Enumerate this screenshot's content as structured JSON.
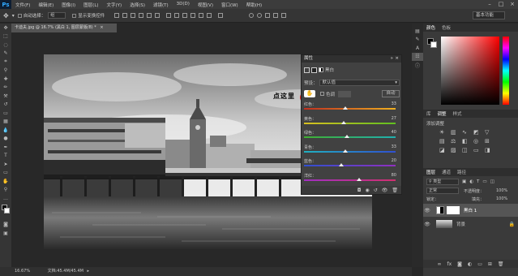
{
  "app": {
    "logo": "Ps"
  },
  "menu": [
    "文件(F)",
    "编辑(E)",
    "图像(I)",
    "图层(L)",
    "文字(Y)",
    "选择(S)",
    "滤镜(T)",
    "3D(D)",
    "视图(V)",
    "窗口(W)",
    "帮助(H)"
  ],
  "options": {
    "auto_select_label": "自动选择：",
    "auto_select_value": "组",
    "transform_label": "显示变换控件",
    "workspace": "基本功能"
  },
  "document": {
    "tab_title": "卡迪夫.jpg @ 16.7% (黑白 1, 图层蒙版/8) *",
    "zoom": "16.67%",
    "doc_info": "文档:45.4M/45.4M"
  },
  "properties": {
    "title": "属性",
    "subtitle": "黑白",
    "preset_label": "预设：",
    "preset_value": "默认值",
    "tint_label": "色调",
    "auto_button": "自动",
    "sliders": [
      {
        "label": "红色：",
        "value": "33",
        "fraction": 0.45,
        "gradient": [
          "#c03020",
          "#f0b020"
        ]
      },
      {
        "label": "黄色：",
        "value": "27",
        "fraction": 0.43,
        "gradient": [
          "#d8c020",
          "#60c020"
        ]
      },
      {
        "label": "绿色：",
        "value": "40",
        "fraction": 0.47,
        "gradient": [
          "#40b030",
          "#20b0b0"
        ]
      },
      {
        "label": "青色：",
        "value": "33",
        "fraction": 0.45,
        "gradient": [
          "#20b0c0",
          "#3050d0"
        ]
      },
      {
        "label": "蓝色：",
        "value": "20",
        "fraction": 0.41,
        "gradient": [
          "#3050d0",
          "#9030c0"
        ]
      },
      {
        "label": "洋红：",
        "value": "80",
        "fraction": 0.6,
        "gradient": [
          "#a030c0",
          "#d03070"
        ]
      }
    ]
  },
  "annotation": {
    "text": "点这里"
  },
  "panels": {
    "color_tabs": [
      "颜色",
      "色板"
    ],
    "adjust_tabs": [
      "库",
      "调整",
      "样式"
    ],
    "adjust_title": "添加调整",
    "layer_tabs": [
      "图层",
      "通道",
      "路径"
    ],
    "kind_label": "类型",
    "blend_mode": "正常",
    "opacity_label": "不透明度：",
    "opacity_value": "100%",
    "lock_label": "锁定：",
    "fill_label": "填充：",
    "fill_value": "100%",
    "layers": [
      {
        "name": "黑白 1"
      },
      {
        "name": "背景"
      }
    ]
  }
}
